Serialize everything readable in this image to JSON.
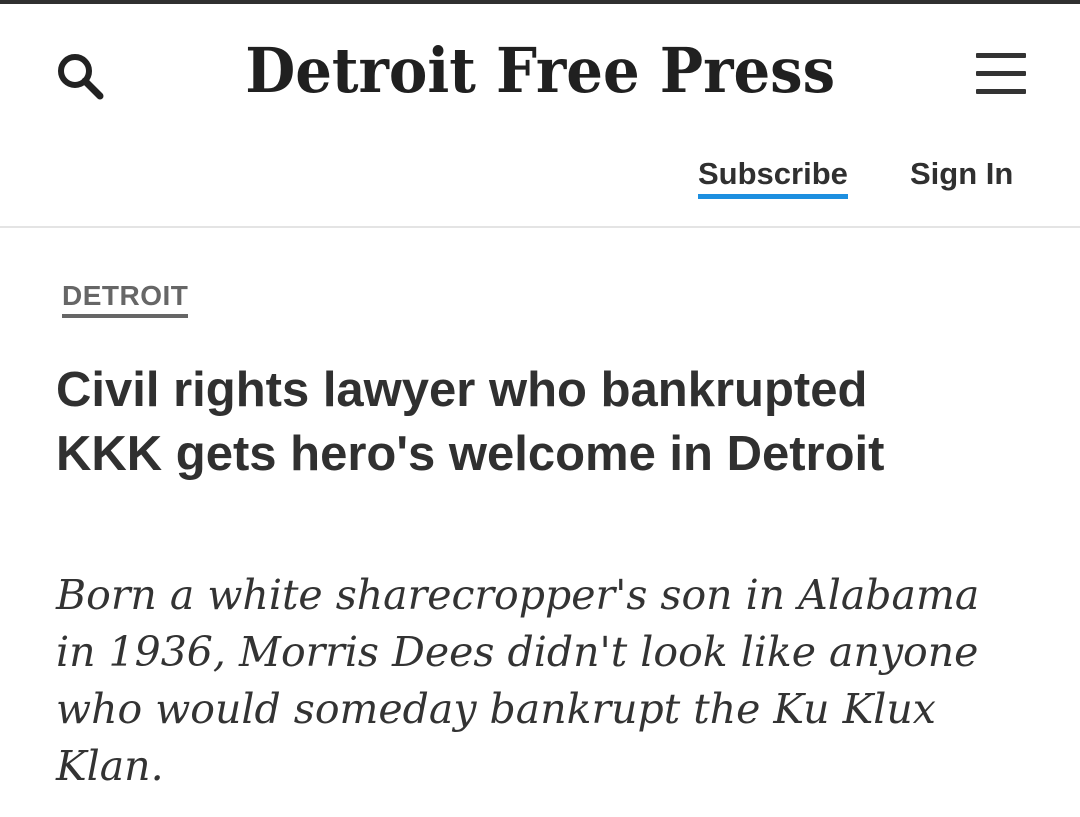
{
  "header": {
    "masthead": "Detroit Free Press",
    "search_icon": "search-icon",
    "menu_icon": "hamburger-menu-icon",
    "subscribe_label": "Subscribe",
    "signin_label": "Sign In",
    "accent_color": "#1d8fe0"
  },
  "article": {
    "section": "DETROIT",
    "headline": "Civil rights lawyer who bankrupted KKK gets hero's welcome in Detroit",
    "summary": "Born a white sharecropper's son in Alabama in 1936, Morris Dees didn't look like anyone who would someday bankrupt the Ku Klux Klan."
  }
}
